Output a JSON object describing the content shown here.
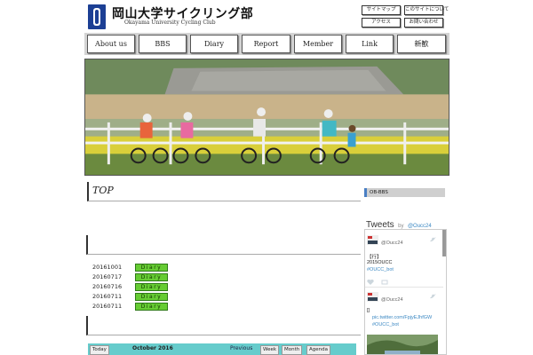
{
  "header": {
    "title": "岡山大学サイクリング部",
    "subtitle": "Okayama University Cycling Club",
    "links": [
      "サイトマップ",
      "このサイトについて",
      "アクセス",
      "お問い合わせ"
    ]
  },
  "nav": {
    "items": [
      "About us",
      "BBS",
      "Diary",
      "Report",
      "Member",
      "Link",
      "新歓"
    ]
  },
  "main": {
    "section_title": "TOP",
    "diary_button_label": "Diary",
    "diary_entries": [
      {
        "date": "20161001"
      },
      {
        "date": "20160717"
      },
      {
        "date": "20160716"
      },
      {
        "date": "20160711"
      },
      {
        "date": "20160711"
      }
    ],
    "calendar": {
      "prev_label": "Previous",
      "week_label": "Week",
      "month_label": "Month",
      "agenda_label": "Agenda",
      "today_label": "Today",
      "title": "October 2016"
    }
  },
  "sidebar": {
    "ob_label": "OB-BBS",
    "tweets_title": "Tweets",
    "tweets_by": "by",
    "tweets_handle": "@Oucc24",
    "tweets": [
      {
        "user": "@Oucc24",
        "lines": [
          "【行】",
          "2015OUCC"
        ],
        "tag": "#OUCC_bot"
      },
      {
        "user": "@Oucc24",
        "lines": [
          "[]"
        ],
        "link": "pic.twitter.com/FpjyEJhfGW",
        "tag": "#OUCC_bot"
      }
    ]
  }
}
